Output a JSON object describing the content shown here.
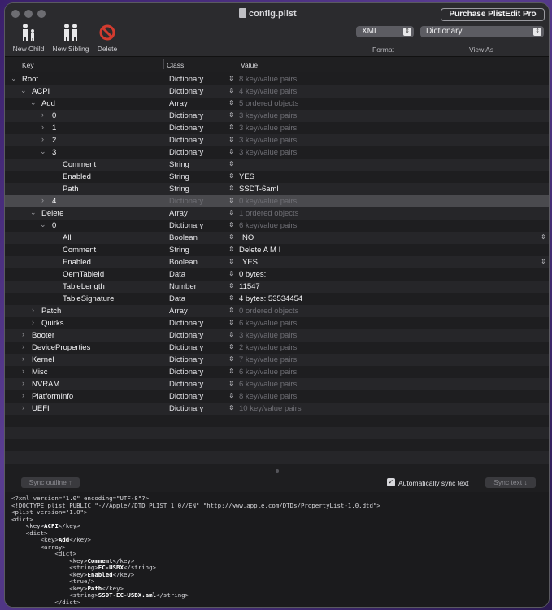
{
  "window": {
    "title": "config.plist",
    "purchase_label": "Purchase PlistEdit Pro"
  },
  "toolbar": {
    "new_child": "New Child",
    "new_sibling": "New Sibling",
    "delete": "Delete",
    "format_value": "XML",
    "format_label": "Format",
    "view_as_value": "Dictionary",
    "view_as_label": "View As"
  },
  "columns": {
    "key": "Key",
    "class": "Class",
    "value": "Value"
  },
  "rows": [
    {
      "key": "Root",
      "class": "Dictionary",
      "value": "8 key/value pairs"
    },
    {
      "key": "ACPI",
      "class": "Dictionary",
      "value": "4 key/value pairs"
    },
    {
      "key": "Add",
      "class": "Array",
      "value": "5 ordered objects"
    },
    {
      "key": "0",
      "class": "Dictionary",
      "value": "3 key/value pairs"
    },
    {
      "key": "1",
      "class": "Dictionary",
      "value": "3 key/value pairs"
    },
    {
      "key": "2",
      "class": "Dictionary",
      "value": "3 key/value pairs"
    },
    {
      "key": "3",
      "class": "Dictionary",
      "value": "3 key/value pairs"
    },
    {
      "key": "Comment",
      "class": "String",
      "value": ""
    },
    {
      "key": "Enabled",
      "class": "String",
      "value": "YES"
    },
    {
      "key": "Path",
      "class": "String",
      "value": "SSDT-6aml"
    },
    {
      "key": "4",
      "class": "Dictionary",
      "value": "0 key/value pairs"
    },
    {
      "key": "Delete",
      "class": "Array",
      "value": "1 ordered objects"
    },
    {
      "key": "0",
      "class": "Dictionary",
      "value": "6 key/value pairs"
    },
    {
      "key": "All",
      "class": "Boolean",
      "value": "NO"
    },
    {
      "key": "Comment",
      "class": "String",
      "value": "Delete A M I"
    },
    {
      "key": "Enabled",
      "class": "Boolean",
      "value": "YES"
    },
    {
      "key": "OemTableId",
      "class": "Data",
      "value": "0 bytes:"
    },
    {
      "key": "TableLength",
      "class": "Number",
      "value": "11547"
    },
    {
      "key": "TableSignature",
      "class": "Data",
      "value": "4 bytes: 53534454"
    },
    {
      "key": "Patch",
      "class": "Array",
      "value": "0 ordered objects"
    },
    {
      "key": "Quirks",
      "class": "Dictionary",
      "value": "6 key/value pairs"
    },
    {
      "key": "Booter",
      "class": "Dictionary",
      "value": "3 key/value pairs"
    },
    {
      "key": "DeviceProperties",
      "class": "Dictionary",
      "value": "2 key/value pairs"
    },
    {
      "key": "Kernel",
      "class": "Dictionary",
      "value": "7 key/value pairs"
    },
    {
      "key": "Misc",
      "class": "Dictionary",
      "value": "6 key/value pairs"
    },
    {
      "key": "NVRAM",
      "class": "Dictionary",
      "value": "6 key/value pairs"
    },
    {
      "key": "PlatformInfo",
      "class": "Dictionary",
      "value": "8 key/value pairs"
    },
    {
      "key": "UEFI",
      "class": "Dictionary",
      "value": "10 key/value pairs"
    }
  ],
  "sync": {
    "sync_outline": "Sync outline ↑",
    "auto_sync": "Automatically sync text",
    "sync_text": "Sync text ↓"
  },
  "xml_lines": [
    {
      "pre": "<?xml version=\"1.0\" encoding=\"UTF-8\"?>",
      "tag": "",
      "post": ""
    },
    {
      "pre": "<!DOCTYPE plist PUBLIC \"-//Apple//DTD PLIST 1.0//EN\" \"http://www.apple.com/DTDs/PropertyList-1.0.dtd\">",
      "tag": "",
      "post": ""
    },
    {
      "pre": "<plist version=\"1.0\">",
      "tag": "",
      "post": ""
    },
    {
      "pre": "<dict>",
      "tag": "",
      "post": ""
    },
    {
      "pre": "    <key>",
      "tag": "ACPI",
      "post": "</key>"
    },
    {
      "pre": "    <dict>",
      "tag": "",
      "post": ""
    },
    {
      "pre": "        <key>",
      "tag": "Add",
      "post": "</key>"
    },
    {
      "pre": "        <array>",
      "tag": "",
      "post": ""
    },
    {
      "pre": "            <dict>",
      "tag": "",
      "post": ""
    },
    {
      "pre": "                <key>",
      "tag": "Comment",
      "post": "</key>"
    },
    {
      "pre": "                <string>",
      "tag": "EC-USBX",
      "post": "</string>"
    },
    {
      "pre": "                <key>",
      "tag": "Enabled",
      "post": "</key>"
    },
    {
      "pre": "                <true/>",
      "tag": "",
      "post": ""
    },
    {
      "pre": "                <key>",
      "tag": "Path",
      "post": "</key>"
    },
    {
      "pre": "                <string>",
      "tag": "SSDT-EC-USBX.aml",
      "post": "</string>"
    },
    {
      "pre": "            </dict>",
      "tag": "",
      "post": ""
    }
  ]
}
